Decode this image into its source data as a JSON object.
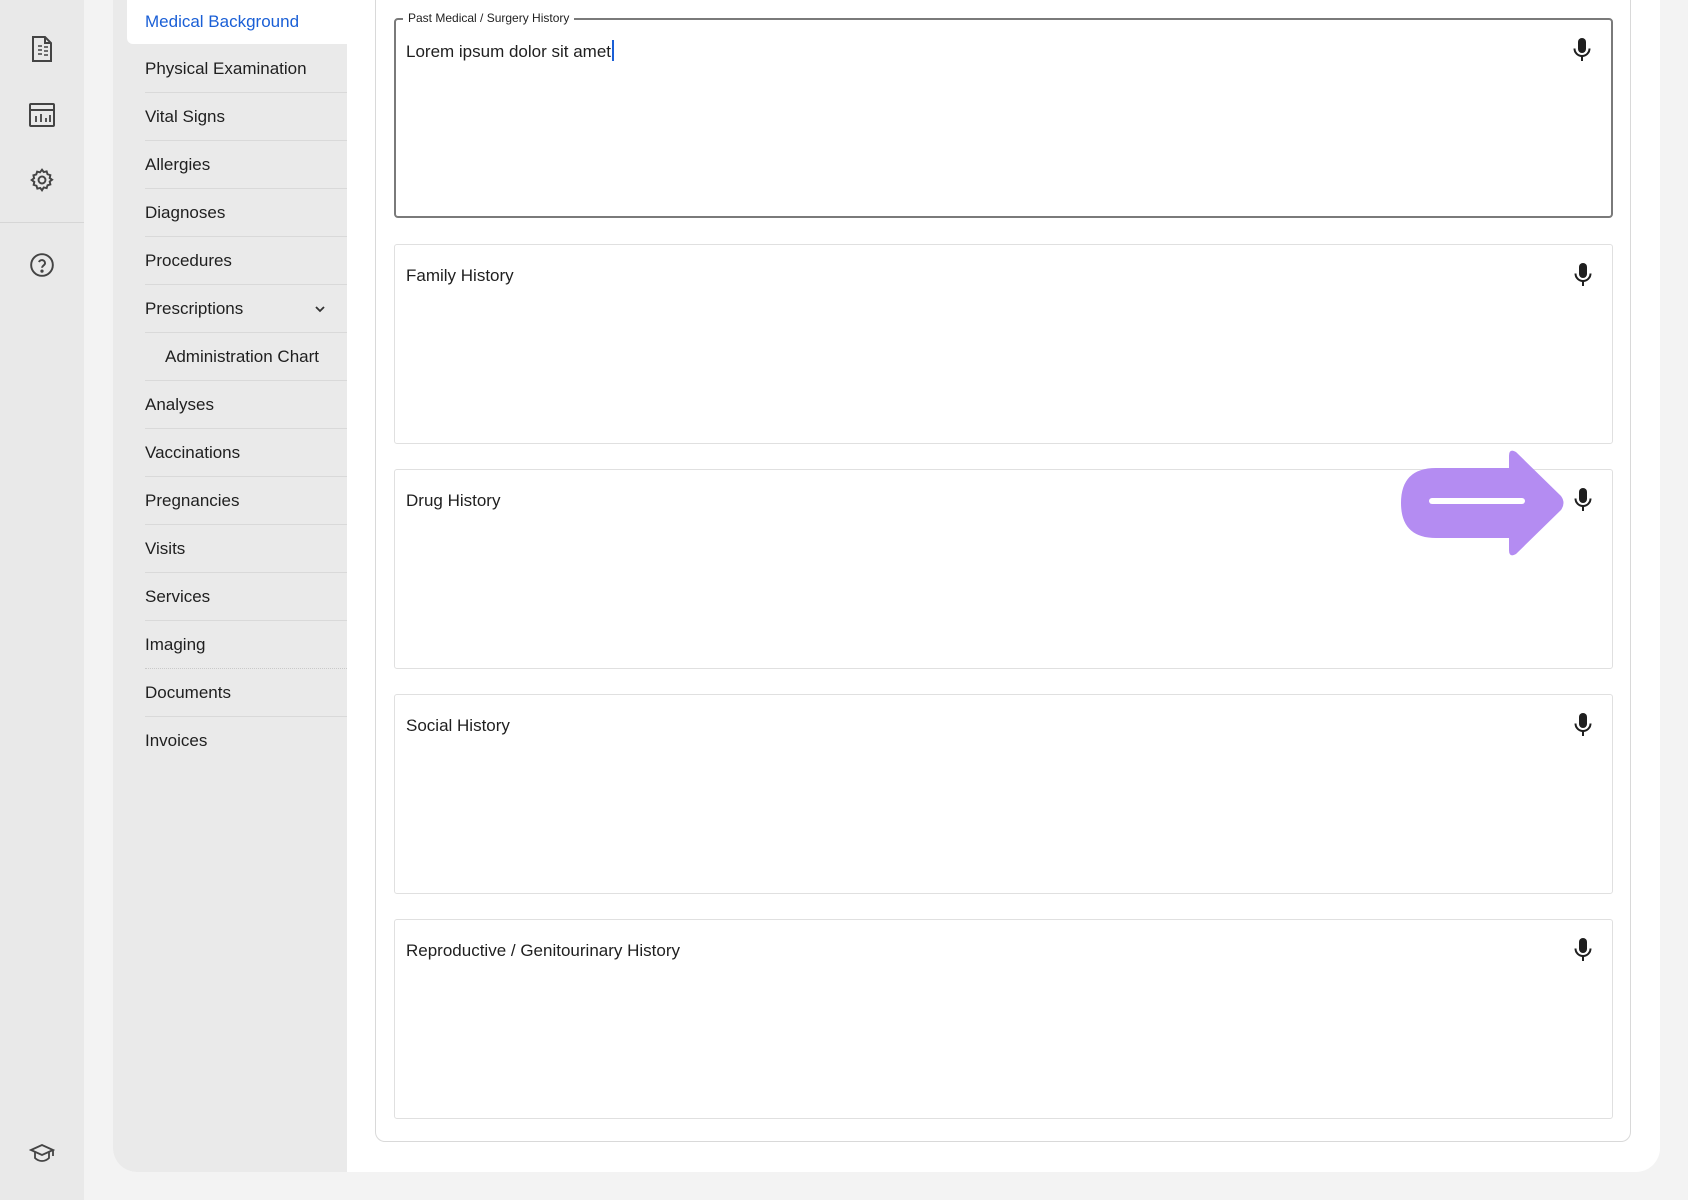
{
  "rail": {
    "icons": [
      {
        "name": "invoice-document-icon"
      },
      {
        "name": "reports-chart-icon"
      },
      {
        "name": "settings-gear-icon"
      },
      {
        "name": "help-circle-icon"
      },
      {
        "name": "graduation-cap-icon"
      }
    ]
  },
  "subnav": {
    "items": [
      {
        "label": "Medical Background",
        "active": true
      },
      {
        "label": "Physical Examination"
      },
      {
        "label": "Vital Signs"
      },
      {
        "label": "Allergies"
      },
      {
        "label": "Diagnoses"
      },
      {
        "label": "Procedures"
      },
      {
        "label": "Prescriptions",
        "expandable": true,
        "expanded": true
      },
      {
        "label": "Administration Chart",
        "child": true
      },
      {
        "label": "Analyses"
      },
      {
        "label": "Vaccinations"
      },
      {
        "label": "Pregnancies"
      },
      {
        "label": "Visits"
      },
      {
        "label": "Services"
      },
      {
        "label": "Imaging"
      },
      {
        "label": "Documents"
      },
      {
        "label": "Invoices"
      }
    ]
  },
  "form": {
    "fields": [
      {
        "label": "Past Medical / Surgery History",
        "value": "Lorem ipsum dolor sit amet",
        "focused": true
      },
      {
        "label": "Family History",
        "value": ""
      },
      {
        "label": "Drug History",
        "value": ""
      },
      {
        "label": "Social History",
        "value": ""
      },
      {
        "label": "Reproductive / Genitourinary History",
        "value": ""
      }
    ],
    "mic_icon": "microphone-icon"
  },
  "annotation": {
    "arrow_color": "#b48cf2"
  },
  "colors": {
    "accent": "#1a5fd6",
    "rail_bg": "#e9e9e9",
    "subnav_bg": "#eaeaea"
  }
}
